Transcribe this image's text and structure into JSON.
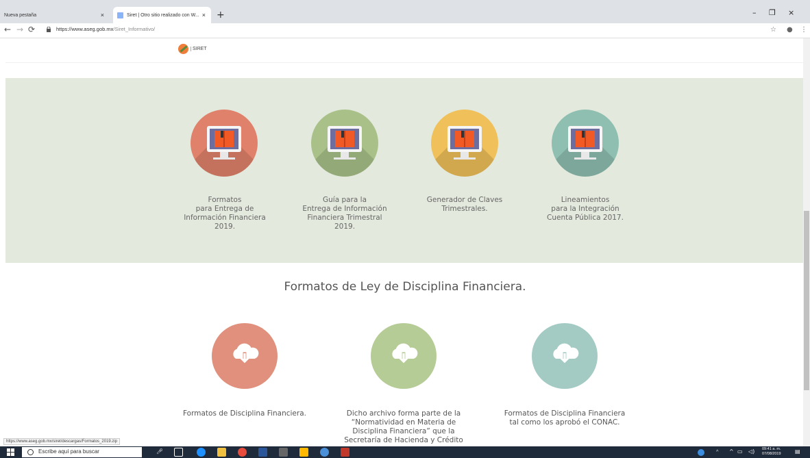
{
  "browser": {
    "tabs": [
      {
        "label": "Nueva pestaña",
        "active": false
      },
      {
        "label": "Siret | Otro sitio realizado con W...",
        "active": true
      }
    ],
    "new_tab_symbol": "+",
    "close_symbol": "×",
    "window_controls": [
      "–",
      "❐",
      "×"
    ],
    "url_host": "https://www.aseg.gob.mx",
    "url_path": "/Siret_Informativo/",
    "status_url": "https://www.aseg.gob.mx/siret/descargas/Formatos_2019.zip"
  },
  "site": {
    "logo_text": "SIRET"
  },
  "resources": [
    {
      "caption": "Formatos\npara Entrega de\nInformación Financiera\n2019.",
      "color": "#e0826b"
    },
    {
      "caption": "Guía para la\nEntrega de Información\nFinanciera Trimestral\n2019.",
      "color": "#a9c189"
    },
    {
      "caption": "Generador de Claves\nTrimestrales.",
      "color": "#f0c05a"
    },
    {
      "caption": "Lineamientos\npara la Integración\nCuenta Pública 2017.",
      "color": "#8ebfb0"
    }
  ],
  "section_title": "Formatos de Ley de Disciplina Financiera.",
  "downloads": [
    {
      "caption": "Formatos de Disciplina Financiera.",
      "color": "#e0907c"
    },
    {
      "caption": "Dicho archivo forma parte de la\n“Normatividad en Materia de\nDisciplina Financiera” que la\nSecretaría de Hacienda y Crédito",
      "color": "#b5cc96"
    },
    {
      "caption": "Formatos de Disciplina Financiera\ntal como los aprobó el CONAC.",
      "color": "#a3cbc4"
    }
  ],
  "taskbar": {
    "search_placeholder": "Escribe aquí para buscar",
    "time": "09:41 a. m.",
    "date": "07/08/2019"
  }
}
